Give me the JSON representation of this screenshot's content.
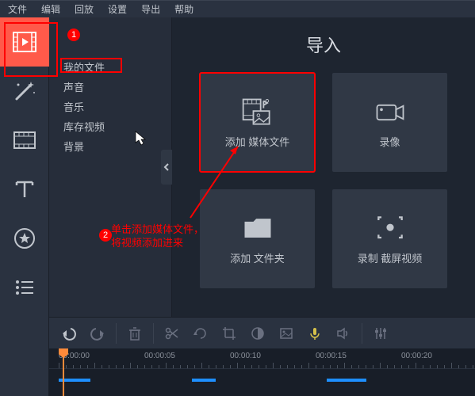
{
  "menu": {
    "file": "文件",
    "edit": "编辑",
    "playback": "回放",
    "settings": "设置",
    "export": "导出",
    "help": "帮助"
  },
  "tools": {
    "import": "import-tab",
    "effects": "effects-tab",
    "transitions": "transitions-tab",
    "text": "text-tab",
    "stickers": "stickers-tab",
    "more": "more-tab"
  },
  "sidebar": {
    "items": [
      {
        "label": "我的文件"
      },
      {
        "label": "声音"
      },
      {
        "label": "音乐"
      },
      {
        "label": "库存视频"
      },
      {
        "label": "背景"
      }
    ]
  },
  "panel": {
    "title": "导入",
    "tiles": [
      {
        "label": "添加\n媒体文件"
      },
      {
        "label": "录像"
      },
      {
        "label": "添加\n文件夹"
      },
      {
        "label": "录制\n截屏视频"
      }
    ]
  },
  "annotations": {
    "badge1": "1",
    "badge2": "2",
    "text": "单击添加媒体文件，\n将视频添加进来"
  },
  "toolbar": {
    "undo": "undo",
    "redo": "redo",
    "delete": "delete",
    "cut": "cut",
    "rotate": "rotate",
    "crop": "crop",
    "color": "color",
    "image": "image",
    "mic": "mic",
    "audio": "audio",
    "adjust": "adjust"
  },
  "timeline": {
    "marks": [
      "00:00:00",
      "00:00:05",
      "00:00:10",
      "00:00:15",
      "00:00:20"
    ]
  }
}
